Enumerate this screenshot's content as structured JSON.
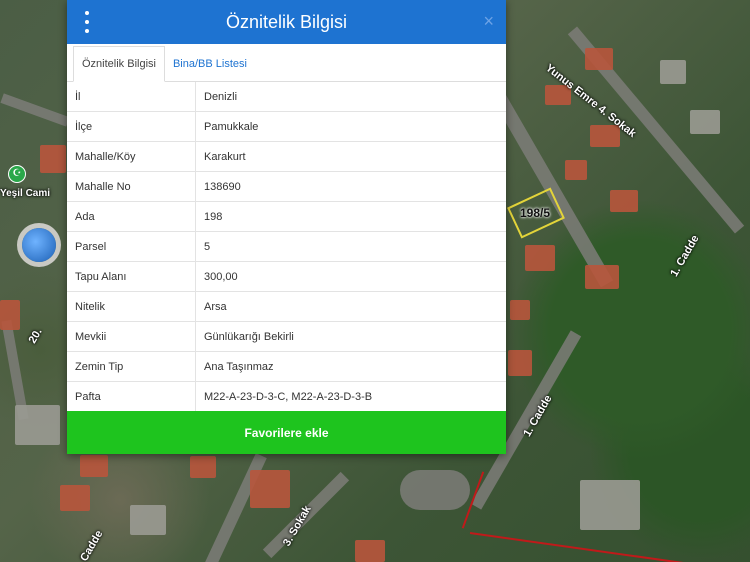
{
  "map": {
    "parcel_label": "198/5",
    "street_labels": [
      "Yunus Emre 4. Sokak",
      "1. Cadde",
      "1. Cadde",
      "20.",
      "Cadde",
      "3. Sokak"
    ],
    "poi_label": "Yeşil Cami"
  },
  "panel": {
    "title": "Öznitelik Bilgisi",
    "tabs": [
      {
        "label": "Öznitelik Bilgisi"
      },
      {
        "label": "Bina/BB Listesi"
      }
    ],
    "rows": [
      {
        "key": "İl",
        "value": "Denizli"
      },
      {
        "key": "İlçe",
        "value": "Pamukkale"
      },
      {
        "key": "Mahalle/Köy",
        "value": "Karakurt"
      },
      {
        "key": "Mahalle No",
        "value": "138690"
      },
      {
        "key": "Ada",
        "value": "198"
      },
      {
        "key": "Parsel",
        "value": "5"
      },
      {
        "key": "Tapu Alanı",
        "value": "300,00"
      },
      {
        "key": "Nitelik",
        "value": "Arsa"
      },
      {
        "key": "Mevkii",
        "value": "Günlükarığı Bekirli"
      },
      {
        "key": "Zemin Tip",
        "value": "Ana Taşınmaz"
      },
      {
        "key": "Pafta",
        "value": "M22-A-23-D-3-C, M22-A-23-D-3-B"
      }
    ],
    "favorite_button": "Favorilere ekle",
    "close_glyph": "×"
  },
  "colors": {
    "header": "#1e73d1",
    "button": "#1ec41e"
  }
}
